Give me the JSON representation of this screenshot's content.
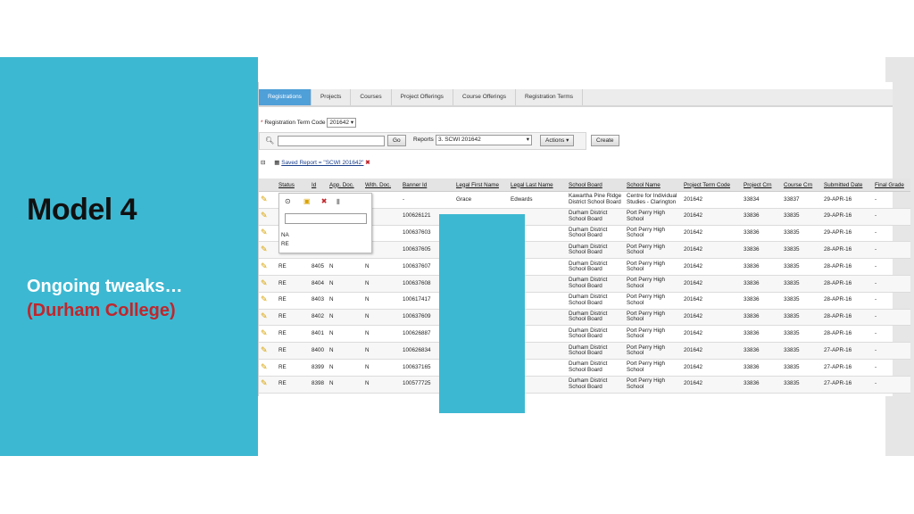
{
  "slide": {
    "title": "Model 4",
    "subtitle": "Ongoing tweaks…",
    "subtitle2": "(Durham College)"
  },
  "app": {
    "tabs": [
      "Registrations",
      "Projects",
      "Courses",
      "Project Offerings",
      "Course Offerings",
      "Registration Terms"
    ],
    "term_label": "Registration Term Code",
    "term_value": "201642",
    "go_label": "Go",
    "reports_label": "Reports",
    "reports_value": "3. SCWI 201642",
    "actions_label": "Actions",
    "create_label": "Create",
    "saved_report": "Saved Report = \"SCWI 201642\"",
    "filter_options": [
      "NA",
      "RE"
    ],
    "columns": [
      "Status",
      "Id",
      "App. Doc.",
      "With. Doc.",
      "Banner Id",
      "Legal First Name",
      "Legal Last Name",
      "School Board",
      "School Name",
      "Project Term Code",
      "Project Crn",
      "Course Crn",
      "Submitted Date",
      "Final Grade"
    ],
    "rows": [
      [
        "",
        "",
        "",
        "",
        "-",
        "Grace",
        "Edwards",
        "Kawartha Pine Ridge District School Board",
        "Centre for Individual Studies - Clarington",
        "201642",
        "33834",
        "33837",
        "29-APR-16",
        "-"
      ],
      [
        "",
        "",
        "",
        "",
        "100626121",
        "",
        "",
        "Durham District School Board",
        "Port Perry High School",
        "201642",
        "33836",
        "33835",
        "29-APR-16",
        "-"
      ],
      [
        "",
        "",
        "",
        "",
        "100637603",
        "",
        "",
        "Durham District School Board",
        "Port Perry High School",
        "201642",
        "33836",
        "33835",
        "29-APR-16",
        "-"
      ],
      [
        "RE",
        "8407",
        "N",
        "N",
        "100637605",
        "",
        "",
        "Durham District School Board",
        "Port Perry High School",
        "201642",
        "33836",
        "33835",
        "28-APR-16",
        "-"
      ],
      [
        "RE",
        "8405",
        "N",
        "N",
        "100637607",
        "",
        "",
        "Durham District School Board",
        "Port Perry High School",
        "201642",
        "33836",
        "33835",
        "28-APR-16",
        "-"
      ],
      [
        "RE",
        "8404",
        "N",
        "N",
        "100637608",
        "",
        "",
        "Durham District School Board",
        "Port Perry High School",
        "201642",
        "33836",
        "33835",
        "28-APR-16",
        "-"
      ],
      [
        "RE",
        "8403",
        "N",
        "N",
        "100617417",
        "",
        "",
        "Durham District School Board",
        "Port Perry High School",
        "201642",
        "33836",
        "33835",
        "28-APR-16",
        "-"
      ],
      [
        "RE",
        "8402",
        "N",
        "N",
        "100637609",
        "",
        "",
        "Durham District School Board",
        "Port Perry High School",
        "201642",
        "33836",
        "33835",
        "28-APR-16",
        "-"
      ],
      [
        "RE",
        "8401",
        "N",
        "N",
        "100626887",
        "",
        "",
        "Durham District School Board",
        "Port Perry High School",
        "201642",
        "33836",
        "33835",
        "28-APR-16",
        "-"
      ],
      [
        "RE",
        "8400",
        "N",
        "N",
        "100626834",
        "",
        "",
        "Durham District School Board",
        "Port Perry High School",
        "201642",
        "33836",
        "33835",
        "27-APR-16",
        "-"
      ],
      [
        "RE",
        "8399",
        "N",
        "N",
        "100637165",
        "",
        "",
        "Durham District School Board",
        "Port Perry High School",
        "201642",
        "33836",
        "33835",
        "27-APR-16",
        "-"
      ],
      [
        "RE",
        "8398",
        "N",
        "N",
        "100577725",
        "",
        "",
        "Durham District School Board",
        "Port Perry High School",
        "201642",
        "33836",
        "33835",
        "27-APR-16",
        "-"
      ]
    ]
  },
  "colors": {
    "panel": "#3db8d2",
    "subtitle2": "#c0262c",
    "tab_active": "#4f9fd8"
  }
}
